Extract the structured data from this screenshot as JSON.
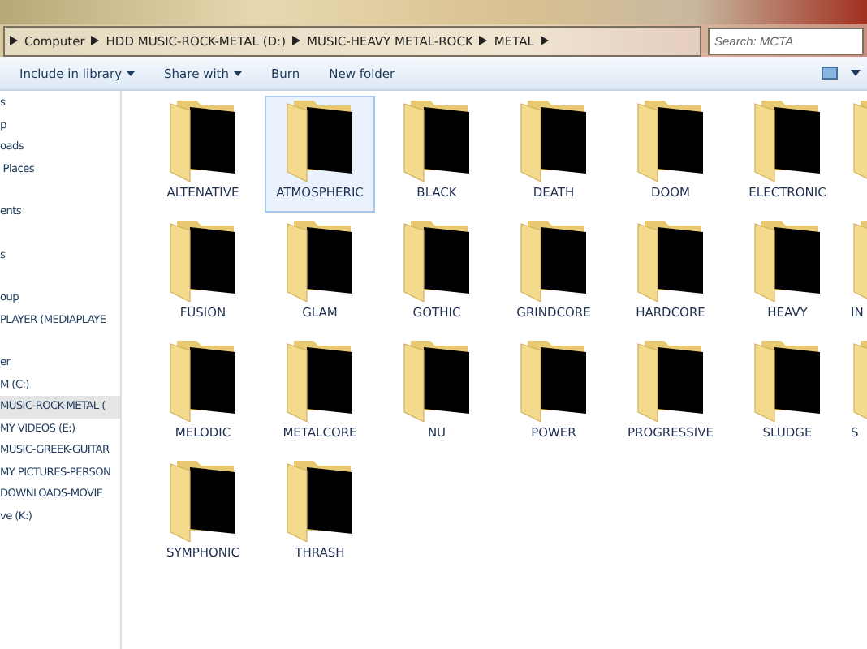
{
  "address_bar": {
    "crumbs": [
      "Computer",
      "HDD MUSIC-ROCK-METAL (D:)",
      "MUSIC-HEAVY METAL-ROCK",
      "METAL"
    ]
  },
  "search": {
    "placeholder": "Search: MCTA"
  },
  "toolbar": {
    "buttons": [
      {
        "label": "Include in library",
        "dropdown": true
      },
      {
        "label": "Share with",
        "dropdown": true
      },
      {
        "label": "Burn",
        "dropdown": false
      },
      {
        "label": "New folder",
        "dropdown": false
      }
    ]
  },
  "sidebar": {
    "sections": [
      {
        "items": [
          {
            "label": "s",
            "selected": false
          },
          {
            "label": "p",
            "selected": false
          },
          {
            "label": "oads",
            "selected": false
          },
          {
            "label": " Places",
            "selected": false
          }
        ]
      },
      {
        "items": [
          {
            "label": "ents",
            "selected": false
          }
        ]
      },
      {
        "items": [
          {
            "label": "s",
            "selected": false
          }
        ]
      },
      {
        "items": [
          {
            "label": "oup",
            "selected": false
          },
          {
            "label": "PLAYER (MEDIAPLAYE",
            "selected": false
          }
        ]
      },
      {
        "items": [
          {
            "label": "er",
            "selected": false
          },
          {
            "label": "M (C:)",
            "selected": false
          },
          {
            "label": "MUSIC-ROCK-METAL (",
            "selected": true
          },
          {
            "label": "MY VIDEOS (E:)",
            "selected": false
          },
          {
            "label": "MUSIC-GREEK-GUITAR",
            "selected": false
          },
          {
            "label": "MY PICTURES-PERSON",
            "selected": false
          },
          {
            "label": "DOWNLOADS-MOVIE",
            "selected": false
          },
          {
            "label": "ve (K:)",
            "selected": false
          }
        ]
      }
    ]
  },
  "folders": [
    {
      "label": "ALTENATIVE",
      "selected": false
    },
    {
      "label": "ATMOSPHERIC",
      "selected": true
    },
    {
      "label": "BLACK",
      "selected": false
    },
    {
      "label": "DEATH",
      "selected": false
    },
    {
      "label": "DOOM",
      "selected": false
    },
    {
      "label": "ELECTRONIC",
      "selected": false
    },
    {
      "selected": false,
      "partial": true
    },
    {
      "label": "FUSION",
      "selected": false
    },
    {
      "label": "GLAM",
      "selected": false
    },
    {
      "label": "GOTHIC",
      "selected": false
    },
    {
      "label": "GRINDCORE",
      "selected": false
    },
    {
      "label": "HARDCORE",
      "selected": false
    },
    {
      "label": "HEAVY",
      "selected": false
    },
    {
      "label": "IN",
      "selected": false,
      "partial": true
    },
    {
      "label": "MELODIC",
      "selected": false
    },
    {
      "label": "METALCORE",
      "selected": false
    },
    {
      "label": "NU",
      "selected": false
    },
    {
      "label": "POWER",
      "selected": false
    },
    {
      "label": "PROGRESSIVE",
      "selected": false
    },
    {
      "label": "SLUDGE",
      "selected": false
    },
    {
      "label": "S",
      "selected": false,
      "partial": true
    },
    {
      "label": "SYMPHONIC",
      "selected": false
    },
    {
      "label": "THRASH",
      "selected": false
    }
  ]
}
